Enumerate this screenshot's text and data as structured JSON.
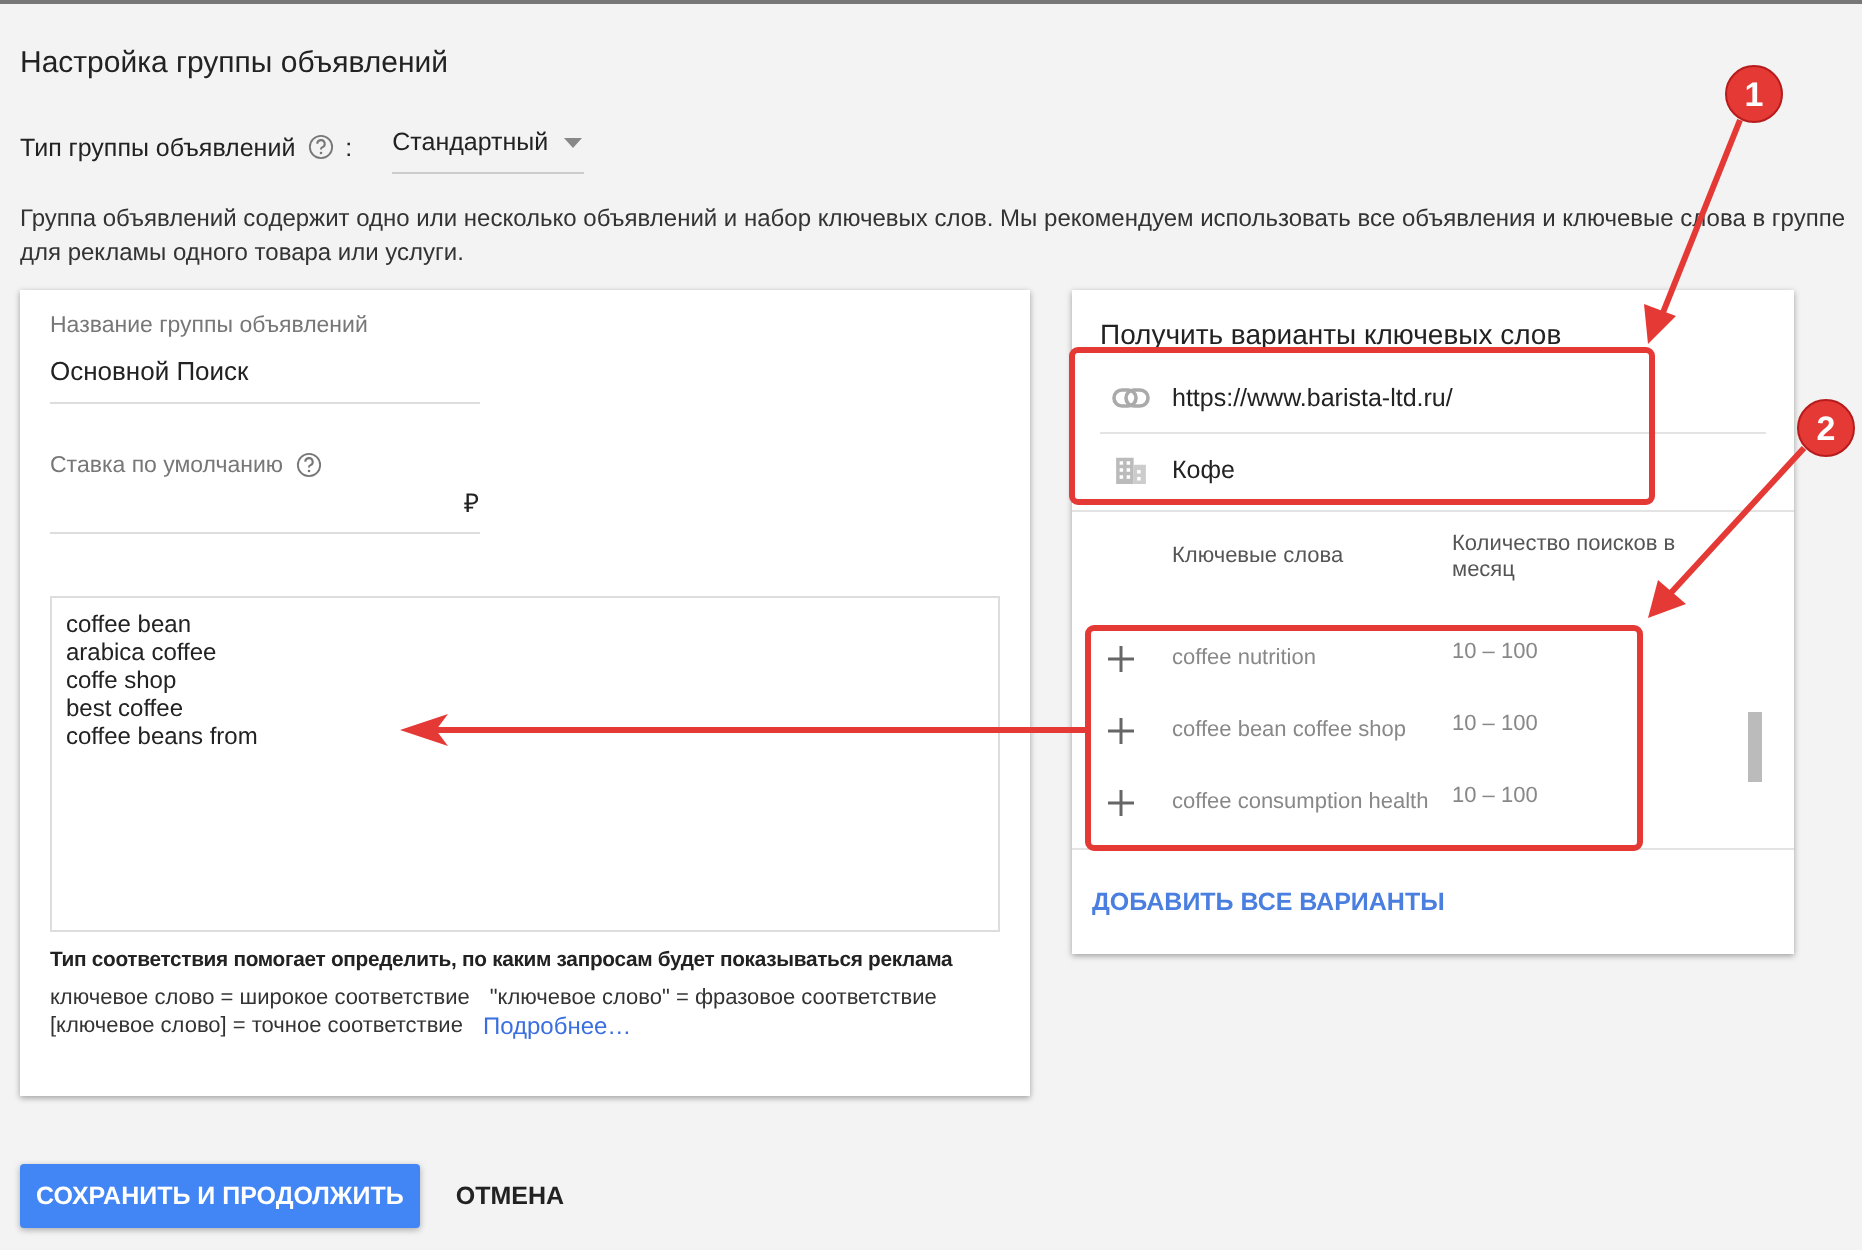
{
  "page": {
    "title": "Настройка группы объявлений",
    "ad_group_type": {
      "label": "Тип группы объявлений",
      "separator": ":",
      "value": "Стандартный"
    },
    "description": "Группа объявлений содержит одно или несколько объявлений и набор ключевых слов. Мы рекомендуем использовать все объявления и ключевые слова в группе для рекламы одного товара или услуги."
  },
  "left_card": {
    "name_field": {
      "label": "Название группы объявлений",
      "value": "Основной Поиск"
    },
    "bid_field": {
      "label": "Ставка по умолчанию",
      "currency": "₽"
    },
    "keywords": [
      "coffee bean",
      "arabica coffee",
      "coffe shop",
      "best coffee",
      "coffee beans from"
    ],
    "match_hint": "Тип соответствия помогает определить, по каким запросам будет показываться реклама",
    "match_types": [
      "ключевое слово = широкое соответствие",
      "\"ключевое слово\" = фразовое соответствие",
      "[ключевое слово] = точное соответствие"
    ],
    "more_link": "Подробнее…"
  },
  "right_card": {
    "title": "Получить варианты ключевых слов",
    "url": "https://www.barista-ltd.ru/",
    "product": "Кофе",
    "columns": [
      "Ключевые слова",
      "Количество поисков в месяц"
    ],
    "suggestions": [
      {
        "keyword": "coffee nutrition",
        "searches": "10 – 100"
      },
      {
        "keyword": "coffee bean coffee shop",
        "searches": "10 – 100"
      },
      {
        "keyword": "coffee consumption health",
        "searches": "10 – 100"
      }
    ],
    "add_all": "ДОБАВИТЬ ВСЕ ВАРИАНТЫ"
  },
  "buttons": [
    {
      "label": "СОХРАНИТЬ И ПРОДОЛЖИТЬ",
      "kind": "primary"
    },
    {
      "label": "ОТМЕНА",
      "kind": "text"
    }
  ],
  "annotations": [
    {
      "label": "1"
    },
    {
      "label": "2"
    }
  ]
}
